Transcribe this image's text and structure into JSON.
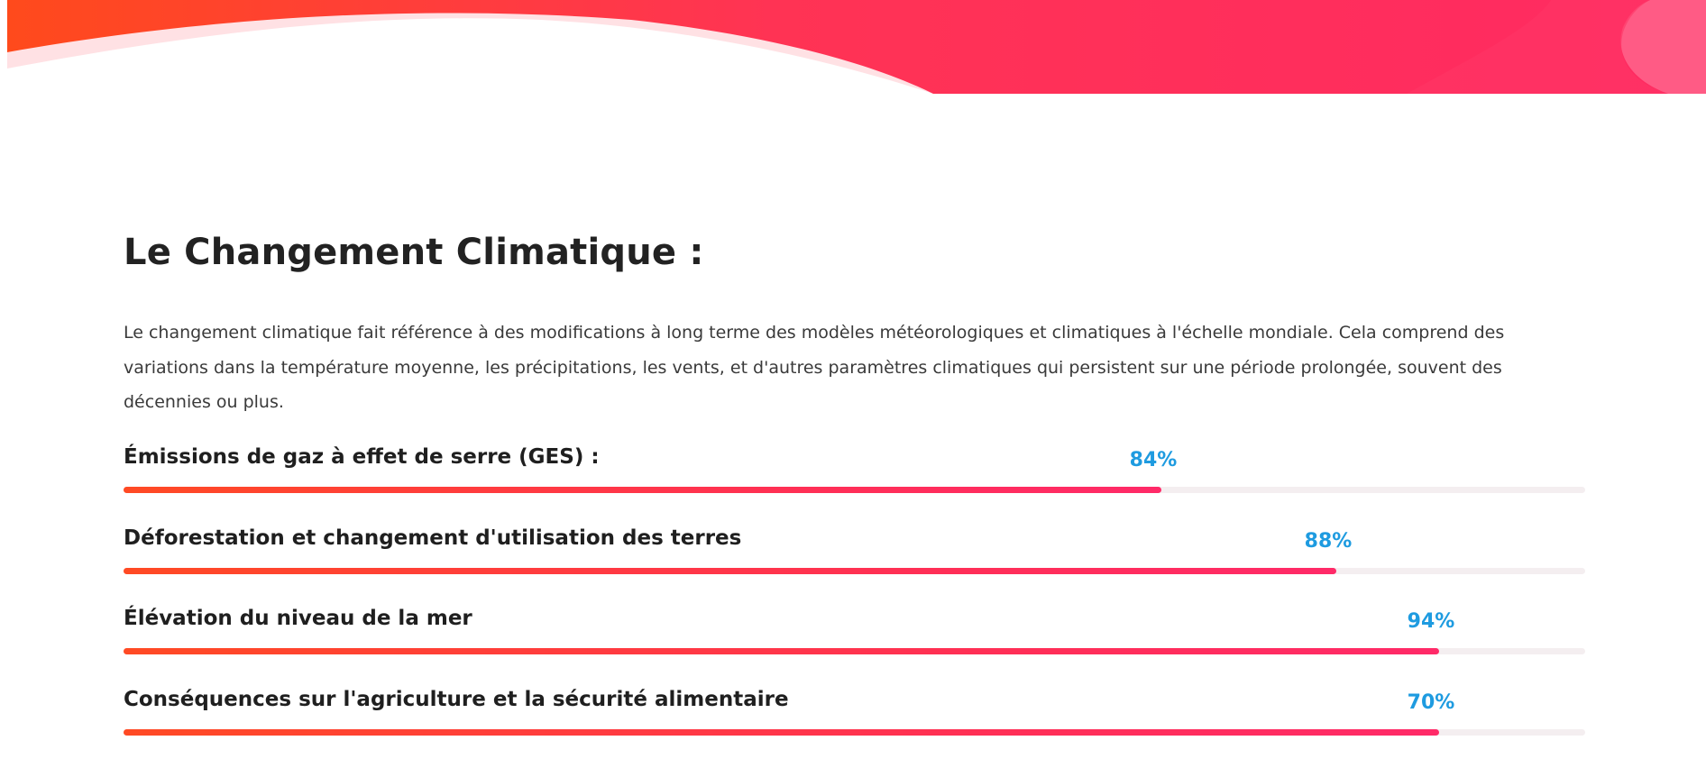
{
  "header": {
    "colors": {
      "wave_start": "#ff4a1c",
      "wave_mid": "#ff3354",
      "wave_end": "#ff2a62",
      "wave_light": "#ffe1e4",
      "wave_accent": "#ff5b85"
    }
  },
  "section": {
    "title": "Le Changement Climatique :",
    "description": "Le changement climatique fait référence à des modifications à long terme des modèles météorologiques et climatiques à l'échelle mondiale. Cela comprend des variations dans la température moyenne, les précipitations, les vents, et d'autres paramètres climatiques qui persistent sur une période prolongée, souvent des décennies ou plus."
  },
  "skills": [
    {
      "label": "Émissions de gaz à effet de serre (GES) :",
      "percent_text": "84%",
      "fill": 0.71
    },
    {
      "label": "Déforestation et changement d'utilisation des terres",
      "percent_text": "88%",
      "fill": 0.83
    },
    {
      "label": "Élévation du niveau de la mer",
      "percent_text": "94%",
      "fill": 0.9
    },
    {
      "label": "Conséquences sur l'agriculture et la sécurité alimentaire",
      "percent_text": "70%",
      "fill": 0.9
    }
  ],
  "colors": {
    "percent": "#1e9be0",
    "bar_start": "#ff4a24",
    "bar_end": "#ff2a68",
    "track": "#f4eef0",
    "title": "#222222"
  }
}
